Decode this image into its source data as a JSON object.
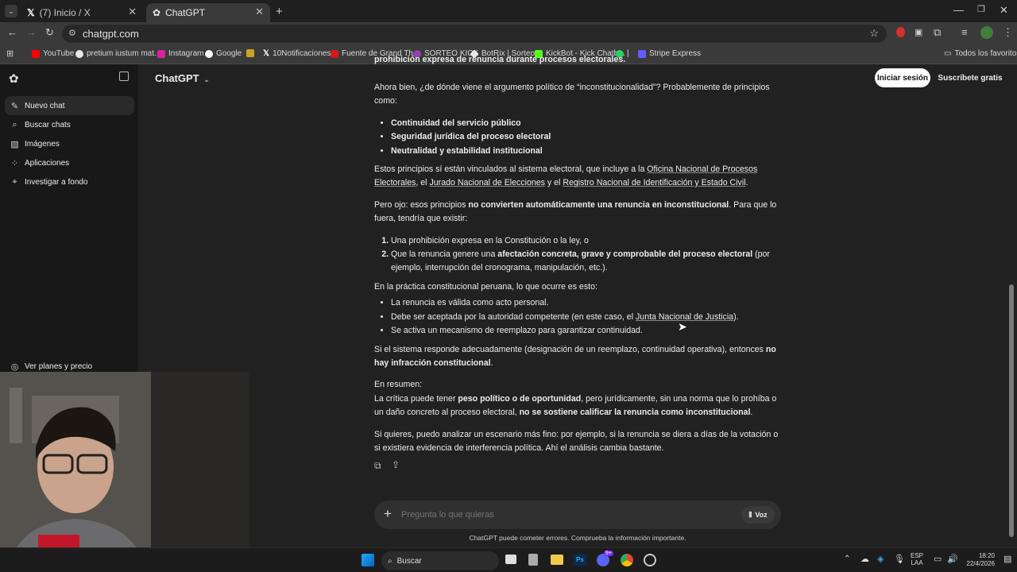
{
  "browser": {
    "tabs": [
      {
        "title": "(7) Inicio / X",
        "icon": "x-logo-icon"
      },
      {
        "title": "ChatGPT",
        "icon": "chatgpt-logo-icon"
      }
    ],
    "url": "chatgpt.com",
    "bookmarks": [
      {
        "label": "YouTube",
        "color": "#ff0000"
      },
      {
        "label": "pretium iustum mat...",
        "color": "#e8e8e8"
      },
      {
        "label": "Instagram",
        "color": "#d6249f"
      },
      {
        "label": "Google",
        "color": "#4285f4"
      },
      {
        "label": "",
        "color": "#c9a227"
      },
      {
        "label": "10Notificaciones",
        "color": "#e8e8e8"
      },
      {
        "label": "Fuente de Grand Th...",
        "color": "#d11a1a"
      },
      {
        "label": "SORTEO KICK",
        "color": "#8e44ad"
      },
      {
        "label": "BotRix | Sorteos",
        "color": "#e8e8e8"
      },
      {
        "label": "KickBot - Kick Chatb...",
        "color": "#53fc18"
      },
      {
        "label": "|",
        "color": "#25d366"
      },
      {
        "label": "Stripe Express",
        "color": "#635bff"
      }
    ],
    "all_bookmarks": "Todos los favoritos"
  },
  "sidebar": {
    "items": [
      {
        "label": "Nuevo chat",
        "icon": "edit-icon"
      },
      {
        "label": "Buscar chats",
        "icon": "search-icon"
      },
      {
        "label": "Imágenes",
        "icon": "image-icon"
      },
      {
        "label": "Aplicaciones",
        "icon": "apps-icon"
      },
      {
        "label": "Investigar a fondo",
        "icon": "telescope-icon"
      }
    ],
    "plans": "Ver planes y precio"
  },
  "header": {
    "title": "ChatGPT",
    "login": "Iniciar sesión",
    "signup": "Suscríbete gratis"
  },
  "content": {
    "top_cut": "prohibición expresa de renuncia durante procesos electorales.",
    "p1": "Ahora bien, ¿de dónde viene el argumento político de “inconstitucionalidad”? Probablemente de principios como:",
    "principles": [
      "Continuidad del servicio público",
      "Seguridad jurídica del proceso electoral",
      "Neutralidad y estabilidad institucional"
    ],
    "p2_a": "Estos principios sí están vinculados al sistema electoral, que incluye a la ",
    "p2_l1": "Oficina Nacional de Procesos Electorales",
    "p2_b": ", el ",
    "p2_l2": "Jurado Nacional de Elecciones",
    "p2_c": " y el ",
    "p2_l3": "Registro Nacional de Identificación y Estado Civil",
    "p2_d": ".",
    "p3_a": "Pero ojo: esos principios ",
    "p3_b": "no convierten automáticamente una renuncia en inconstitucional",
    "p3_c": ". Para que lo fuera, tendría que existir:",
    "ol1": "Una prohibición expresa en la Constitución o la ley, o",
    "ol2_a": "Que la renuncia genere una ",
    "ol2_b": "afectación concreta, grave y comprobable del proceso electoral",
    "ol2_c": " (por ejemplo, interrupción del cronograma, manipulación, etc.).",
    "p4": "En la práctica constitucional peruana, lo que ocurre es esto:",
    "ul2_1": "La renuncia es válida como acto personal.",
    "ul2_2a": "Debe ser aceptada por la autoridad competente (en este caso, el ",
    "ul2_2l": "Junta Nacional de Justicia",
    "ul2_2b": ").",
    "ul2_3": "Se activa un mecanismo de reemplazo para garantizar continuidad.",
    "p5_a": "Si el sistema responde adecuadamente (designación de un reemplazo, continuidad operativa), entonces ",
    "p5_b": "no hay infracción constitucional",
    "p5_c": ".",
    "p6_head": "En resumen:",
    "p6_a": "La crítica puede tener ",
    "p6_b": "peso político o de oportunidad",
    "p6_c": ", pero jurídicamente, sin una norma que lo prohíba o un daño concreto al proceso electoral, ",
    "p6_d": "no se sostiene calificar la renuncia como inconstitucional",
    "p6_e": ".",
    "p7": "Si quieres, puedo analizar un escenario más fino: por ejemplo, si la renuncia se diera a días de la votación o si existiera evidencia de interferencia política. Ahí el análisis cambia bastante."
  },
  "composer": {
    "placeholder": "Pregunta lo que quieras",
    "voice": "Voz"
  },
  "disclaimer": "ChatGPT puede cometer errores. Comprueba la información importante.",
  "taskbar": {
    "search": "Buscar",
    "lang1": "ESP",
    "lang2": "LAA",
    "time": "18:20",
    "date": "22/4/2026",
    "discord_badge": "9+"
  }
}
